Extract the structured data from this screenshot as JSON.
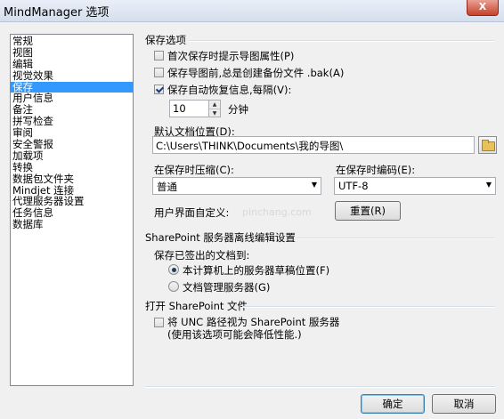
{
  "window": {
    "title": "MindManager 选项",
    "close_glyph": "X"
  },
  "sidebar": {
    "items": [
      "常规",
      "视图",
      "编辑",
      "视觉效果",
      "保存",
      "用户信息",
      "备注",
      "拼写检查",
      "审阅",
      "安全警报",
      "加载项",
      "转换",
      "数据包文件夹",
      "Mindjet 连接",
      "代理服务器设置",
      "任务信息",
      "数据库"
    ],
    "selected": "保存"
  },
  "save_options": {
    "title": "保存选项",
    "checkbox1": "首次保存时提示导图属性(P)",
    "checkbox2": "保存导图前,总是创建备份文件 .bak(A)",
    "checkbox3": "保存自动恢复信息,每隔(V):",
    "interval_value": "10",
    "interval_unit": "分钟",
    "default_location_label": "默认文档位置(D):",
    "default_location_value": "C:\\Users\\THINK\\Documents\\我的导图\\",
    "compress_label": "在保存时压缩(C):",
    "compress_value": "普通",
    "encoding_label": "在保存时编码(E):",
    "encoding_value": "UTF-8",
    "ui_custom_label": "用户界面自定义:",
    "reset_button": "重置(R)",
    "watermark": "pinchang.com"
  },
  "sharepoint": {
    "title": "SharePoint 服务器离线编辑设置",
    "checked_out_label": "保存已签出的文档到:",
    "radio1": "本计算机上的服务器草稿位置(F)",
    "radio2": "文档管理服务器(G)"
  },
  "open_sharepoint": {
    "title": "打开 SharePoint 文件",
    "checkbox_line1": "将 UNC 路径视为 SharePoint 服务器",
    "checkbox_line2": "(使用该选项可能会降低性能.)"
  },
  "footer": {
    "ok": "确定",
    "cancel": "取消"
  }
}
